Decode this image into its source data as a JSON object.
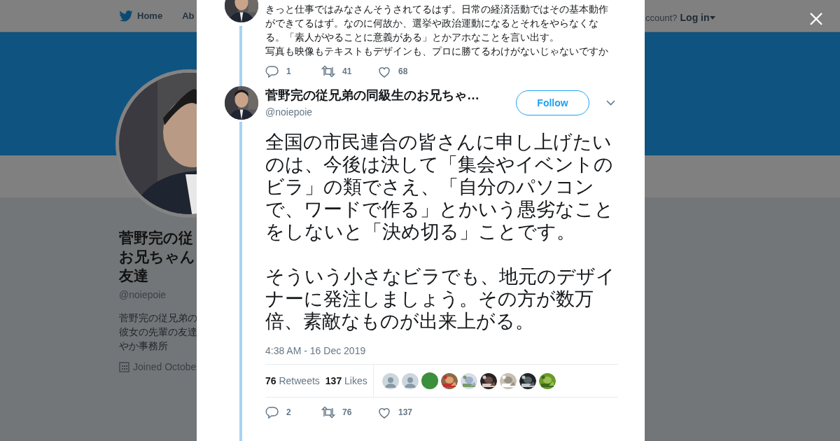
{
  "background_page": {
    "nav": [
      {
        "label": "Home",
        "kind": "home"
      },
      {
        "label": "Ab",
        "kind": "plain"
      }
    ],
    "account_prompt": "ccount?",
    "login": "Log in",
    "profile": {
      "name_lines": [
        "菅野完の従",
        "お兄ちゃん",
        "友達"
      ],
      "handle": "@noiepoie",
      "bio_lines": [
        "菅野完の従兄弟の",
        "彼女の先輩の友達",
        "やか事務所"
      ],
      "joined": "Joined Octobe"
    }
  },
  "modal": {
    "tweets": [
      {
        "kind": "context",
        "text_lines": [
          "きっと仕事ではみなさんそうされてるはず。日常の経済活動ではその基本動作",
          "ができてるはず。なのに何故か、選挙や政治運動になるとそれをやらなくな",
          "る。「素人がやることに意義がある」とかアホなことを言い出す。",
          "写真も映像もテキストもデザインも、プロに勝てるわけがないじゃないですか"
        ],
        "actions": {
          "replies": "1",
          "retweets": "41",
          "likes": "68"
        }
      },
      {
        "kind": "main",
        "name": "菅野完の従兄弟の同級生のお兄ちゃ…",
        "handle": "@noiepoie",
        "follow": "Follow",
        "paragraphs": [
          "全国の市民連合の皆さんに申し上げたいのは、今後は決して「集会やイベントのビラ」の類でさえ、「自分のパソコンで、ワードで作る」とかいう愚劣なことをしないと「決め切る」ことです。",
          "そういう小さなビラでも、地元のデザイナーに発注しましょう。その方が数万倍、素敵なものが出来上がる。"
        ],
        "time": "4:38 AM - 16 Dec 2019",
        "retweet_count": "76",
        "retweet_label": "Retweets",
        "like_count": "137",
        "like_label": "Likes",
        "likers": [
          {
            "kind": "silhouette"
          },
          {
            "kind": "silhouette"
          },
          {
            "kind": "solid",
            "color": "#3c8f3c"
          },
          {
            "kind": "picture"
          },
          {
            "kind": "picture"
          },
          {
            "kind": "picture"
          },
          {
            "kind": "picture"
          },
          {
            "kind": "picture"
          },
          {
            "kind": "picture"
          }
        ],
        "actions": {
          "replies": "2",
          "retweets": "76",
          "likes": "137"
        }
      }
    ]
  }
}
